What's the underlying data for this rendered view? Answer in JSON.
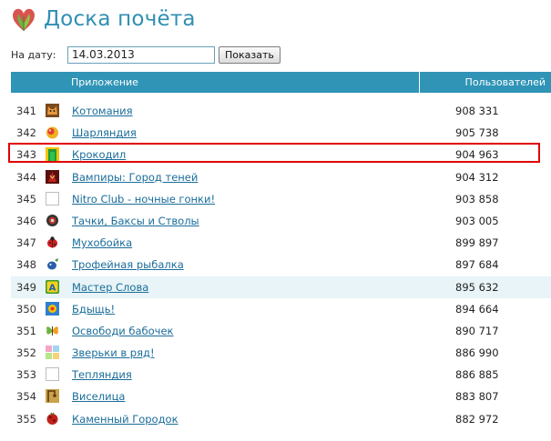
{
  "header": {
    "title": "Доска почёта",
    "logo_icon": "leaf-heart-logo-icon"
  },
  "filter": {
    "date_label": "На дату:",
    "date_value": "14.03.2013",
    "show_button": "Показать"
  },
  "table": {
    "columns": [
      "Приложение",
      "Пользователей"
    ],
    "rows": [
      {
        "rank": "341",
        "app": "Котомания",
        "users": "908 331",
        "icon": "cat-icon"
      },
      {
        "rank": "342",
        "app": "Шарляндия",
        "users": "905 738",
        "icon": "balls-icon"
      },
      {
        "rank": "343",
        "app": "Крокодил",
        "users": "904 963",
        "icon": "crocodile-icon"
      },
      {
        "rank": "344",
        "app": "Вампиры: Город теней",
        "users": "904 312",
        "icon": "vampire-icon"
      },
      {
        "rank": "345",
        "app": "Nitro Club - ночные гонки!",
        "users": "903 858",
        "icon": "blank-icon"
      },
      {
        "rank": "346",
        "app": "Тачки, Баксы и Стволы",
        "users": "903 005",
        "icon": "wheel-icon"
      },
      {
        "rank": "347",
        "app": "Мухобойка",
        "users": "899 897",
        "icon": "ladybug-icon"
      },
      {
        "rank": "348",
        "app": "Трофейная рыбалка",
        "users": "897 684",
        "icon": "fish-icon"
      },
      {
        "rank": "349",
        "app": "Мастер Слова",
        "users": "895 632",
        "icon": "letter-a-icon"
      },
      {
        "rank": "350",
        "app": "Бдыщь!",
        "users": "894 664",
        "icon": "bdysch-icon"
      },
      {
        "rank": "351",
        "app": "Освободи бабочек",
        "users": "890 717",
        "icon": "butterfly-icon"
      },
      {
        "rank": "352",
        "app": "Зверьки в ряд!",
        "users": "886 990",
        "icon": "animals-icon"
      },
      {
        "rank": "353",
        "app": "Тепляндия",
        "users": "886 885",
        "icon": "blank-icon"
      },
      {
        "rank": "354",
        "app": "Виселица",
        "users": "883 807",
        "icon": "gallows-icon"
      },
      {
        "rank": "355",
        "app": "Каменный Городок",
        "users": "882 972",
        "icon": "stone-town-icon"
      }
    ],
    "highlighted_rank": "349",
    "selected_rank": "343"
  },
  "colors": {
    "accent": "#2f94b6",
    "title": "#2f8fb2",
    "link": "#1a6d9a",
    "selection": "#e00000",
    "row_highlight": "#e8f4f7"
  }
}
